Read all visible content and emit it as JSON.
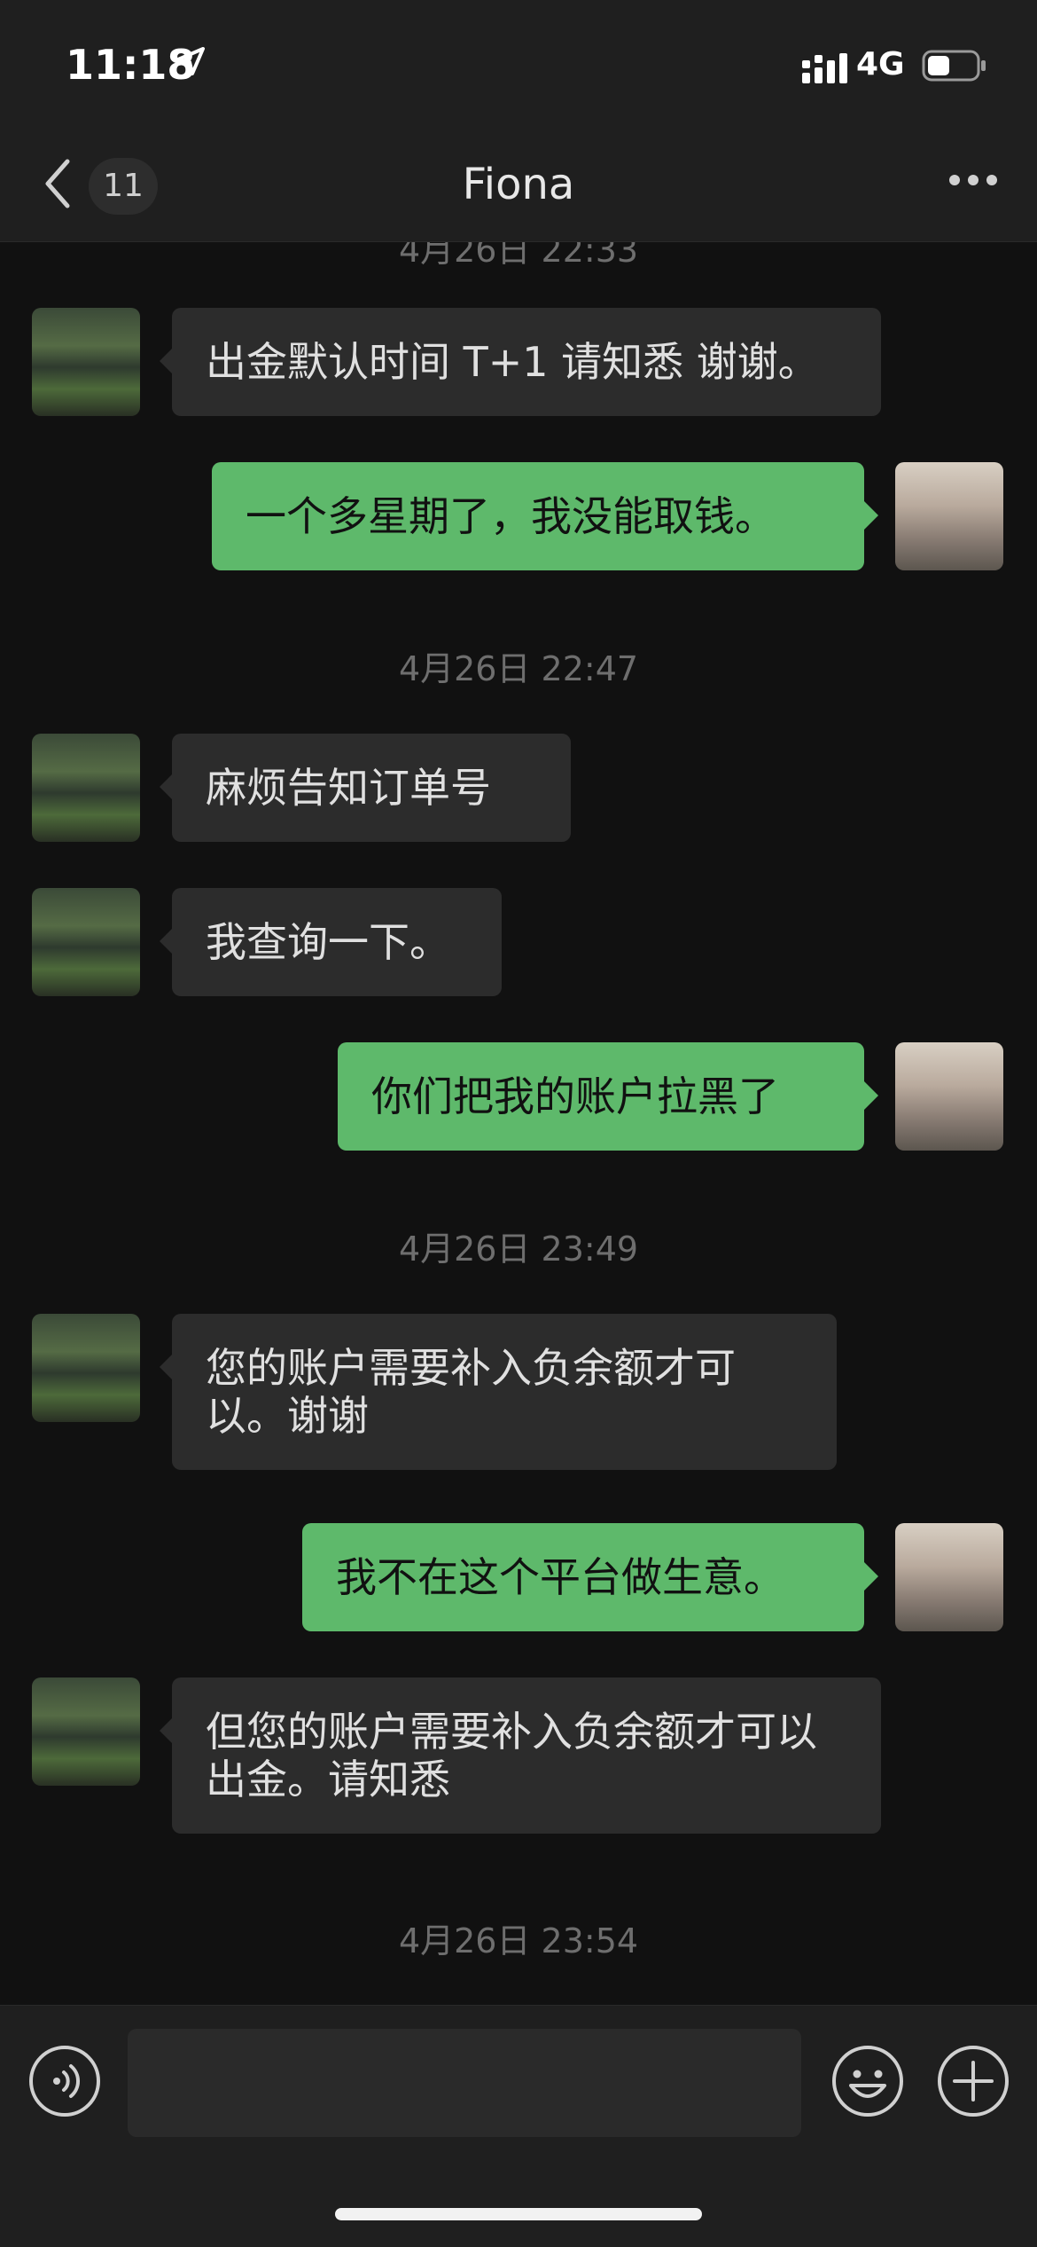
{
  "status_bar": {
    "time": "11:18",
    "network": "4G"
  },
  "nav": {
    "unread_count": "11",
    "title": "Fiona"
  },
  "messages": [
    {
      "type": "timestamp",
      "text": "4月26日 22:33"
    },
    {
      "type": "in",
      "text": "出金默认时间 T+1 请知悉 谢谢。"
    },
    {
      "type": "out",
      "text": "一个多星期了，我没能取钱。"
    },
    {
      "type": "timestamp",
      "text": "4月26日 22:47"
    },
    {
      "type": "in",
      "text": "麻烦告知订单号"
    },
    {
      "type": "in",
      "text": "我查询一下。"
    },
    {
      "type": "out",
      "text": "你们把我的账户拉黑了"
    },
    {
      "type": "timestamp",
      "text": "4月26日 23:49"
    },
    {
      "type": "in",
      "text": "您的账户需要补入负余额才可以。谢谢"
    },
    {
      "type": "out",
      "text": "我不在这个平台做生意。"
    },
    {
      "type": "in",
      "text": "但您的账户需要补入负余额才可以出金。请知悉"
    },
    {
      "type": "timestamp",
      "text": "4月26日 23:54"
    }
  ],
  "colors": {
    "outgoing_bubble": "#5eb96b",
    "incoming_bubble": "#2c2c2c",
    "background": "#111111"
  }
}
